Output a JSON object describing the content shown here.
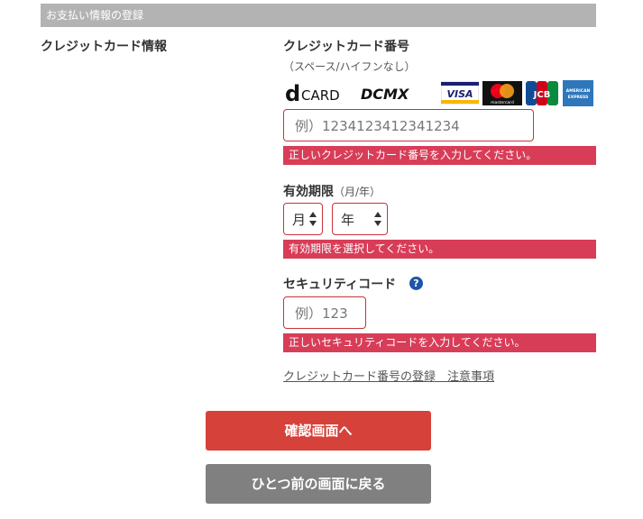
{
  "section": {
    "title": "お支払い情報の登録"
  },
  "left_label": "クレジットカード情報",
  "card_number": {
    "title": "クレジットカード番号",
    "hint": "（スペース/ハイフンなし）",
    "placeholder": "例）1234123412341234",
    "error": "正しいクレジットカード番号を入力してください。"
  },
  "card_brands": {
    "dcard": "CARD",
    "dcmx": "DCMX",
    "visa": "VISA",
    "mastercard": "mastercard",
    "jcb": "JCB",
    "amex": "AMERICAN EXPRESS"
  },
  "expiry": {
    "title": "有効期限",
    "hint": "（月/年）",
    "month": "月",
    "year": "年",
    "error": "有効期限を選択してください。"
  },
  "security": {
    "title": "セキュリティコード",
    "help": "?",
    "placeholder": "例）123",
    "error": "正しいセキュリティコードを入力してください。"
  },
  "notes_link": "クレジットカード番号の登録　注意事項",
  "buttons": {
    "confirm": "確認画面へ",
    "back": "ひとつ前の画面に戻る"
  },
  "colors": {
    "confirm": "#d6413a",
    "back": "#808080",
    "error": "#d83d58",
    "header": "#b3b3b3",
    "help": "#1f55a9"
  }
}
